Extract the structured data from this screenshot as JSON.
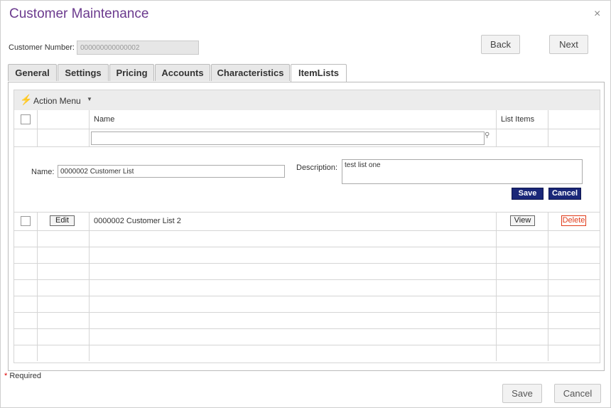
{
  "window": {
    "title": "Customer Maintenance",
    "close_glyph": "×"
  },
  "customer": {
    "label": "Customer Number:",
    "value": "000000000000002"
  },
  "nav": {
    "back": "Back",
    "next": "Next"
  },
  "tabs": [
    {
      "label": "General"
    },
    {
      "label": "Settings"
    },
    {
      "label": "Pricing"
    },
    {
      "label": "Accounts"
    },
    {
      "label": "Characteristics"
    },
    {
      "label": "ItemLists",
      "active": true
    }
  ],
  "action_menu": {
    "label": "Action Menu",
    "icon": "lightning-icon"
  },
  "grid": {
    "columns": [
      "",
      "",
      "Name",
      "List Items",
      ""
    ],
    "filter_placeholder": ""
  },
  "edit_form": {
    "name_label": "Name:",
    "name_value": "0000002 Customer List",
    "description_label": "Description:",
    "description_value": "test list one",
    "save": "Save",
    "cancel": "Cancel"
  },
  "rows": [
    {
      "name": "0000002 Customer List 2",
      "edit": "Edit",
      "view": "View",
      "delete": "Delete"
    }
  ],
  "footer": {
    "required_star": "*",
    "required_text": " Required",
    "save": "Save",
    "cancel": "Cancel"
  },
  "colors": {
    "title": "#6b3a8e",
    "navy_button": "#1a2778",
    "delete": "#e03b1a",
    "bolt": "#f0a30a"
  }
}
